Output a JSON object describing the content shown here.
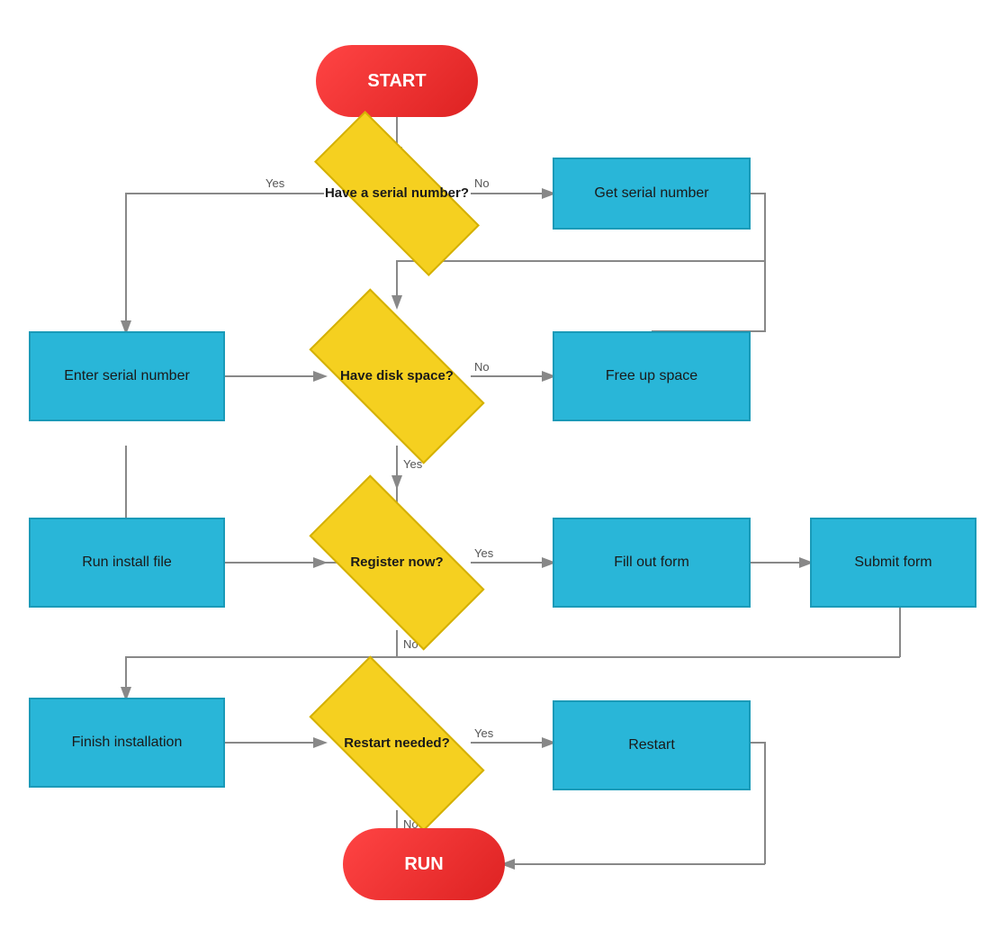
{
  "nodes": {
    "start": {
      "label": "START",
      "type": "terminal"
    },
    "have_serial": {
      "label": "Have a serial number?",
      "type": "decision"
    },
    "get_serial": {
      "label": "Get serial number",
      "type": "process"
    },
    "enter_serial": {
      "label": "Enter serial number",
      "type": "process"
    },
    "have_disk": {
      "label": "Have disk space?",
      "type": "decision"
    },
    "free_space": {
      "label": "Free up space",
      "type": "process"
    },
    "run_install": {
      "label": "Run install file",
      "type": "process"
    },
    "register_now": {
      "label": "Register now?",
      "type": "decision"
    },
    "fill_form": {
      "label": "Fill out form",
      "type": "process"
    },
    "submit_form": {
      "label": "Submit form",
      "type": "process"
    },
    "finish_install": {
      "label": "Finish installation",
      "type": "process"
    },
    "restart_needed": {
      "label": "Restart needed?",
      "type": "decision"
    },
    "restart": {
      "label": "Restart",
      "type": "process"
    },
    "run": {
      "label": "RUN",
      "type": "terminal"
    }
  },
  "labels": {
    "yes": "Yes",
    "no": "No"
  }
}
